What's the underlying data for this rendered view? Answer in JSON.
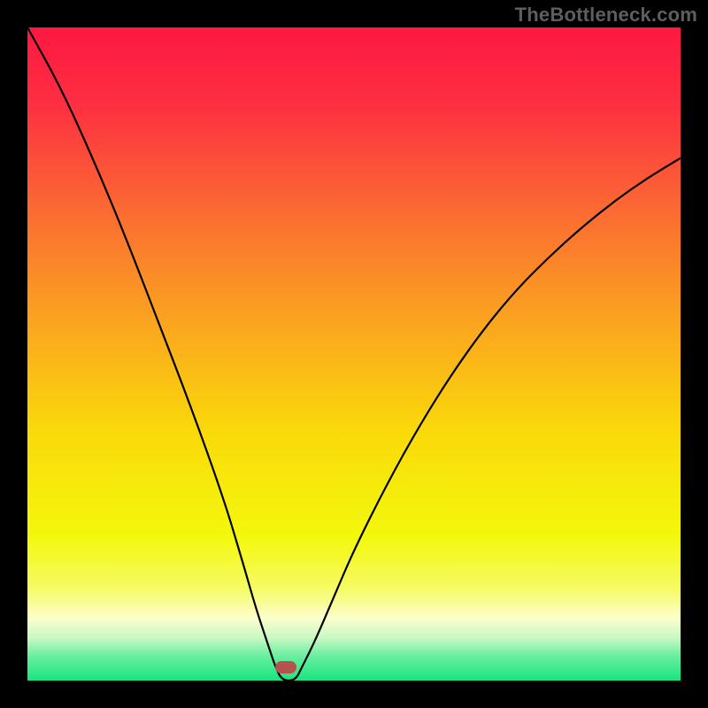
{
  "watermark": "TheBottleneck.com",
  "colors": {
    "background_black": "#000000",
    "curve": "#000000",
    "marker": "#b6524d",
    "gradient_stops": [
      {
        "offset": 0.0,
        "color": "#fd1841"
      },
      {
        "offset": 0.12,
        "color": "#fd3041"
      },
      {
        "offset": 0.28,
        "color": "#fb6a32"
      },
      {
        "offset": 0.45,
        "color": "#fba41f"
      },
      {
        "offset": 0.62,
        "color": "#fada0a"
      },
      {
        "offset": 0.78,
        "color": "#f3f80c"
      },
      {
        "offset": 0.86,
        "color": "#f6fb66"
      },
      {
        "offset": 0.905,
        "color": "#fbfecd"
      },
      {
        "offset": 0.935,
        "color": "#c7f8c3"
      },
      {
        "offset": 0.962,
        "color": "#6beea0"
      },
      {
        "offset": 1.0,
        "color": "#17e580"
      }
    ]
  },
  "chart_data": {
    "type": "line",
    "title": "",
    "xlabel": "",
    "ylabel": "",
    "xlim": [
      0,
      100
    ],
    "ylim": [
      0,
      100
    ],
    "notch_x": 39,
    "marker": {
      "x": 39.5,
      "y": 2
    },
    "series": [
      {
        "name": "v-curve",
        "x": [
          0,
          5,
          10,
          15,
          20,
          25,
          30,
          33,
          35,
          37,
          38,
          39,
          41,
          42,
          44,
          47,
          50,
          55,
          60,
          65,
          70,
          75,
          80,
          85,
          90,
          95,
          100
        ],
        "values": [
          100,
          91,
          80,
          68,
          55,
          42,
          28,
          18,
          11,
          5,
          2,
          0,
          0,
          2,
          6,
          13,
          20,
          30,
          39,
          47,
          54,
          60,
          65,
          69.5,
          73.5,
          77,
          80
        ]
      }
    ]
  }
}
